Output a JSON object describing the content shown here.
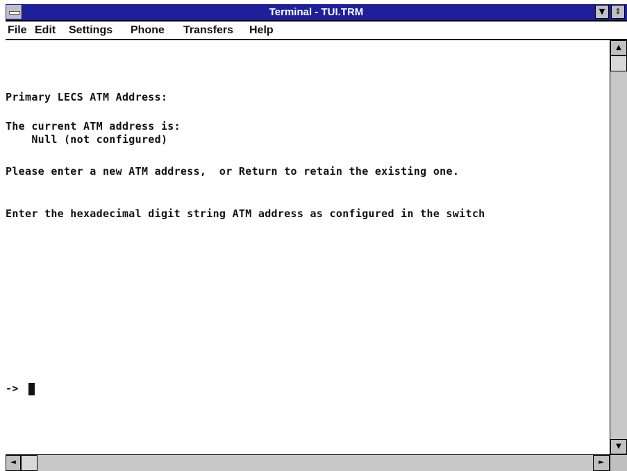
{
  "window": {
    "title": "Terminal - TUI.TRM",
    "minimize_glyph": "▼",
    "restore_glyph": "⇕"
  },
  "menu": [
    "File",
    "Edit",
    "Settings",
    "Phone",
    "Transfers",
    "Help"
  ],
  "terminal": {
    "lines": [
      "Primary LECS ATM Address:",
      "The current ATM address is:",
      "    Null (not configured)",
      "Please enter a new ATM address,  or Return to retain the existing one.",
      "Enter the hexadecimal digit string ATM address as configured in the switch",
      "->"
    ]
  },
  "scrollbar": {
    "up_glyph": "▲",
    "down_glyph": "▼",
    "left_glyph": "◄",
    "right_glyph": "►"
  }
}
